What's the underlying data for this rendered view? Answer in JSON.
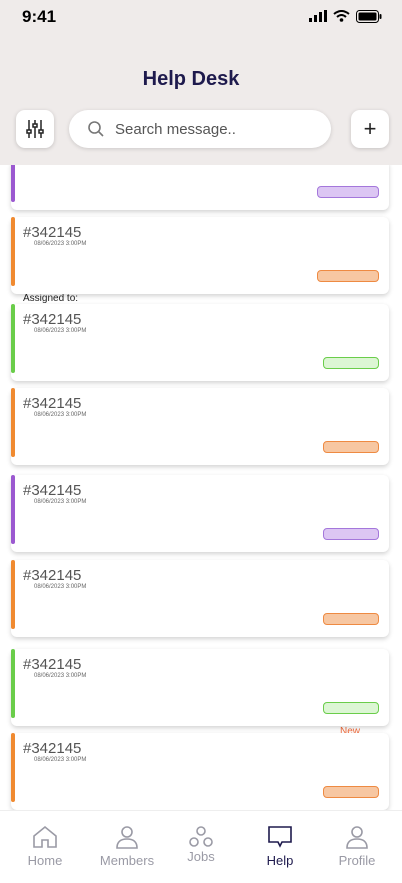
{
  "status_bar": {
    "time": "9:41"
  },
  "header": {
    "title": "Help Desk"
  },
  "search": {
    "placeholder": "Search message.."
  },
  "colors": {
    "purple": "#9b59d0",
    "orange": "#f08a30",
    "green": "#6acd4a",
    "purple_pill_bg": "#dcc6f3",
    "orange_pill_bg": "#f7c7a2",
    "green_pill_bg": "#dcf6d4"
  },
  "tickets": [
    {
      "id": "",
      "date": "",
      "accent": "purple-accent"
    },
    {
      "id": "#342145",
      "date": "08/06/2023 3:00PM",
      "accent": "orange-accent"
    },
    {
      "id": "#342145",
      "date": "08/06/2023 3:00PM",
      "accent": "green-accent"
    },
    {
      "id": "#342145",
      "date": "08/06/2023 3:00PM",
      "accent": "orange-accent"
    },
    {
      "id": "#342145",
      "date": "08/06/2023 3:00PM",
      "accent": "purple-accent"
    },
    {
      "id": "#342145",
      "date": "08/06/2023 3:00PM",
      "accent": "orange-accent"
    },
    {
      "id": "#342145",
      "date": "08/06/2023 3:00PM",
      "accent": "green-accent"
    },
    {
      "id": "#342145",
      "date": "08/06/2023 3:00PM",
      "accent": "orange-accent"
    }
  ],
  "underlay_text": {
    "assigned_to": "Assigned to:",
    "new_badge": "New"
  },
  "nav": {
    "items": [
      {
        "label": "Home",
        "icon": "home-icon"
      },
      {
        "label": "Members",
        "icon": "user-icon"
      },
      {
        "label": "Jobs",
        "icon": "jobs-icon"
      },
      {
        "label": "Help",
        "icon": "chat-icon"
      },
      {
        "label": "Profile",
        "icon": "profile-icon"
      }
    ],
    "active": "Help"
  }
}
